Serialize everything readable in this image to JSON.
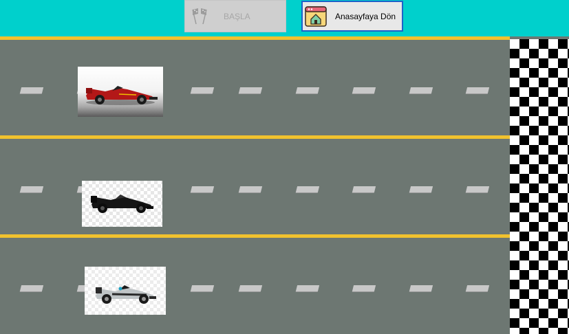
{
  "toolbar": {
    "start_label": "BAŞLA",
    "start_enabled": false,
    "start_icon": "checkered-flags-icon",
    "home_label": "Anasayfaya Dön",
    "home_icon": "home-window-icon"
  },
  "track": {
    "lanes": 3,
    "finish_line": "checkered-flag",
    "cars": [
      {
        "lane": 1,
        "livery": "red"
      },
      {
        "lane": 2,
        "livery": "black"
      },
      {
        "lane": 3,
        "livery": "silver"
      }
    ]
  },
  "colors": {
    "toolbar_bg": "#00d0cc",
    "asphalt": "#6d7772",
    "lane_stripe": "#f1c22e",
    "dash": "#c8c8c8",
    "home_border": "#1d62c9"
  }
}
